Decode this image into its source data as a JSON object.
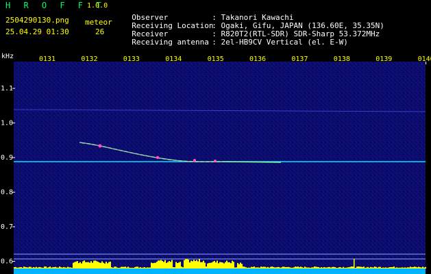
{
  "app": {
    "brand": "H R O F F T",
    "version": "1.0.0",
    "filename": "2504290130.png",
    "datetime": "25.04.29 01:30",
    "meteor_label": "meteor",
    "meteor_count": "26"
  },
  "info": [
    {
      "label": "Observer",
      "value": ": Takanori Kawachi"
    },
    {
      "label": "Receiving Location",
      "value": ": Ogaki, Gifu, JAPAN (136.60E, 35.35N)"
    },
    {
      "label": "Receiver",
      "value": ": R820T2(RTL-SDR) SDR-Sharp 53.372MHz"
    },
    {
      "label": "Receiving antenna",
      "value": ": 2el-HB9CV Vertical (el. E-W)"
    }
  ],
  "axis": {
    "y_unit": "kHz",
    "y_ticks": [
      "1.1",
      "1.0",
      "0.9",
      "0.8",
      "0.7",
      "0.6"
    ],
    "x_ticks": [
      "0131",
      "0132",
      "0133",
      "0134",
      "0135",
      "0136",
      "0137",
      "0138",
      "0139",
      "0140"
    ]
  },
  "colors": {
    "background": "#000000",
    "waterfall": "#0a0a6e",
    "carrier": "#00ffff",
    "echo": "#ff4fc8",
    "noise_bar": "#ffff00",
    "bottom_strip": "#00bfff"
  }
}
